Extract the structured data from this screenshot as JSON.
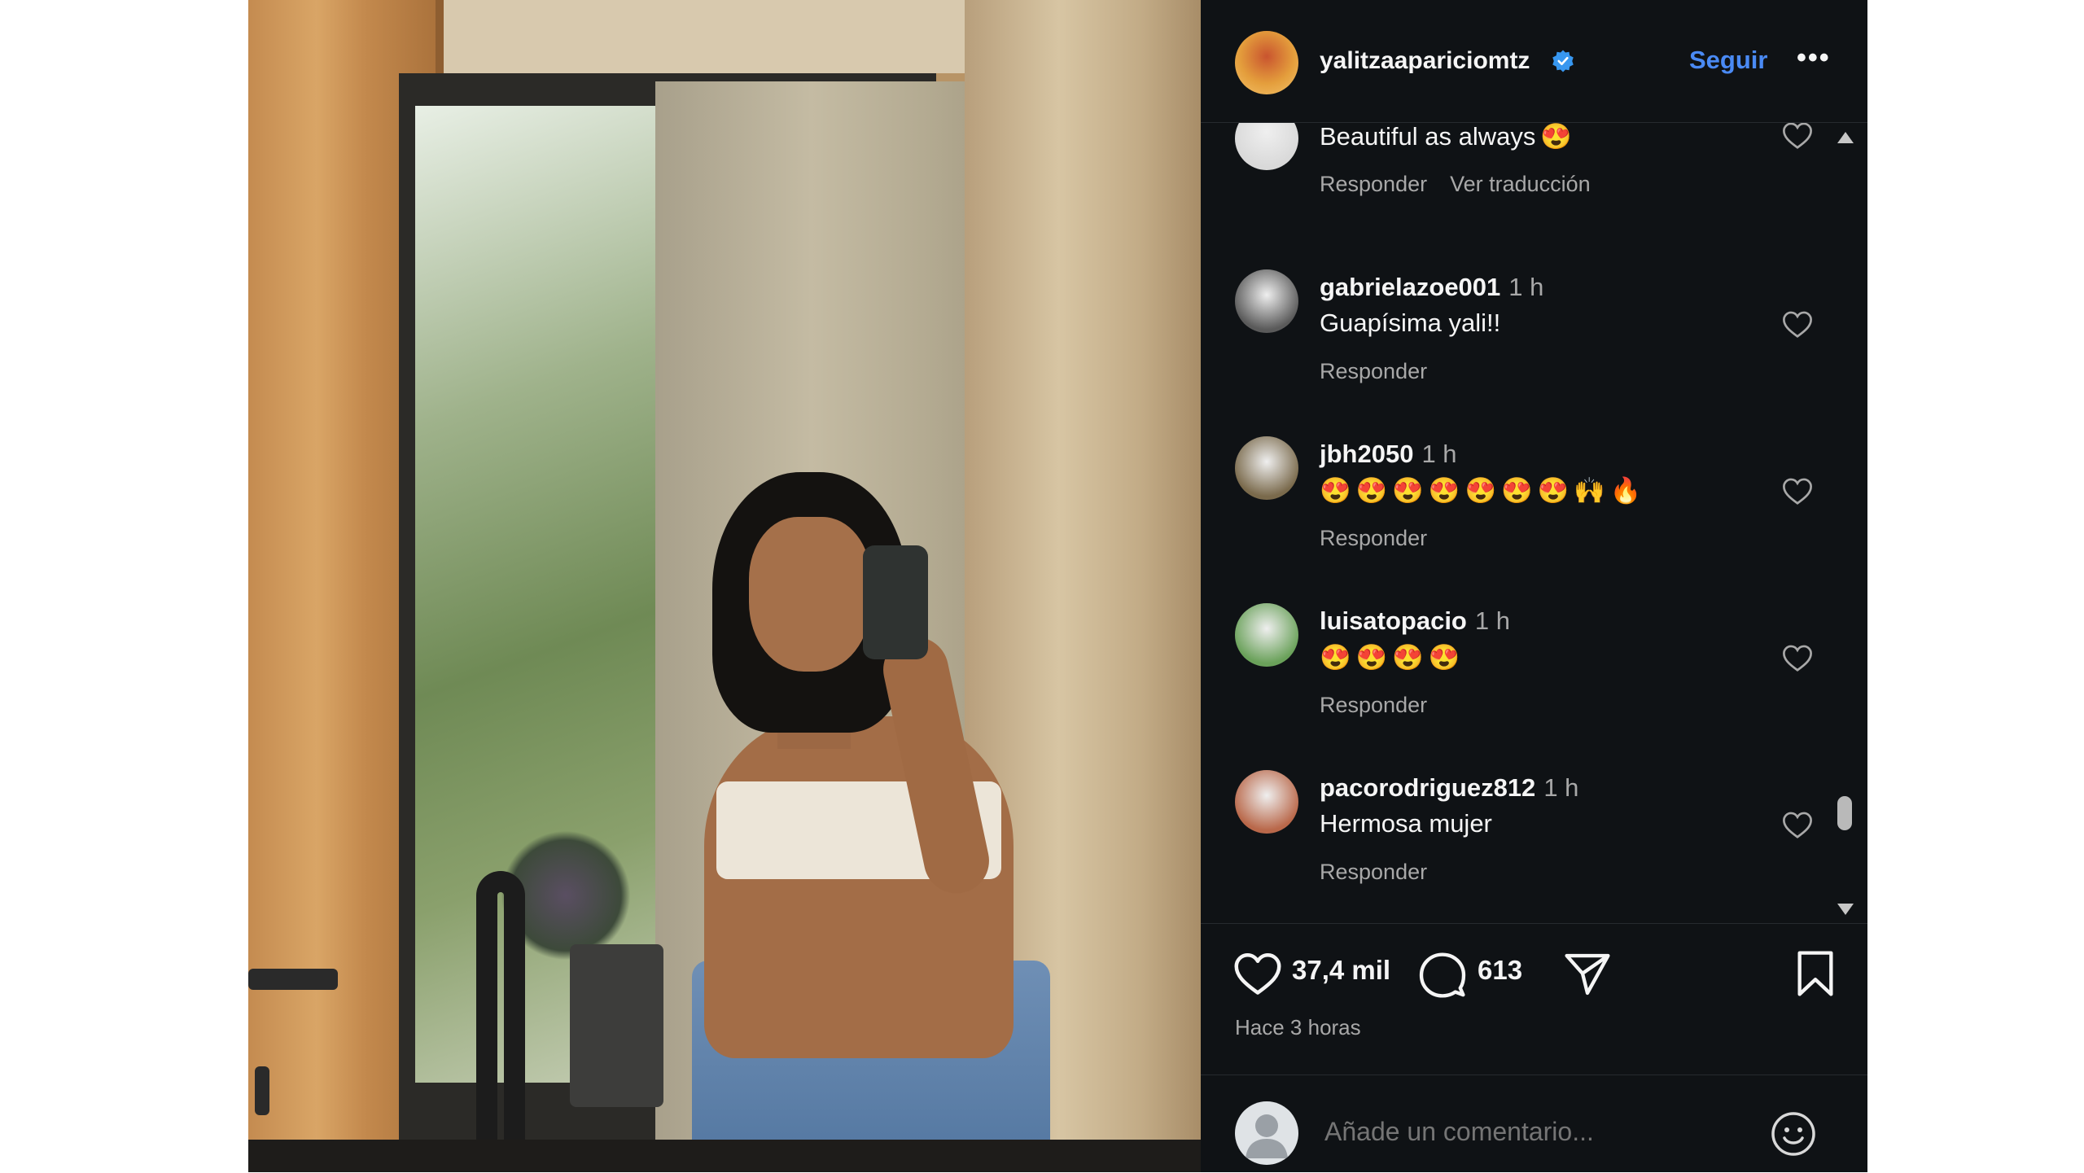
{
  "post": {
    "username": "yalitzaapariciomtz",
    "follow_label": "Seguir",
    "more_label": "•••"
  },
  "comments": [
    {
      "user": "",
      "time": "",
      "text": "Beautiful as always",
      "emojis": [
        "😍"
      ],
      "actions": [
        "Responder",
        "Ver traducción"
      ],
      "avatar_color": "#d9d9d9"
    },
    {
      "user": "gabrielazoe001",
      "time": "1 h",
      "text": "Guapísima yali!!",
      "emojis": [],
      "actions": [
        "Responder"
      ],
      "avatar_color": "#5a5a5a"
    },
    {
      "user": "jbh2050",
      "time": "1 h",
      "text": "",
      "emojis": [
        "😍",
        "😍",
        "😍",
        "😍",
        "😍",
        "😍",
        "😍",
        "🙌",
        "🔥"
      ],
      "actions": [
        "Responder"
      ],
      "avatar_color": "#7a6a4c"
    },
    {
      "user": "luisatopacio",
      "time": "1 h",
      "text": "",
      "emojis": [
        "😍",
        "😍",
        "😍",
        "😍"
      ],
      "actions": [
        "Responder"
      ],
      "avatar_color": "#6aa15a"
    },
    {
      "user": "pacorodriguez812",
      "time": "1 h",
      "text": "Hermosa mujer",
      "emojis": [],
      "actions": [
        "Responder"
      ],
      "avatar_color": "#b9684a"
    }
  ],
  "stats": {
    "likes": "37,4 mil",
    "comments": "613",
    "posted": "Hace 3 horas"
  },
  "add_comment": {
    "placeholder": "Añade un comentario..."
  },
  "icons": {
    "verified": "verified-badge-icon",
    "like": "heart-icon",
    "comment": "comment-bubble-icon",
    "share": "share-send-icon",
    "save": "bookmark-icon",
    "emoji": "smiley-icon"
  },
  "colors": {
    "panel_bg": "#0f1215",
    "accent": "#4a8af4",
    "muted_text": "#a8a8a8"
  }
}
